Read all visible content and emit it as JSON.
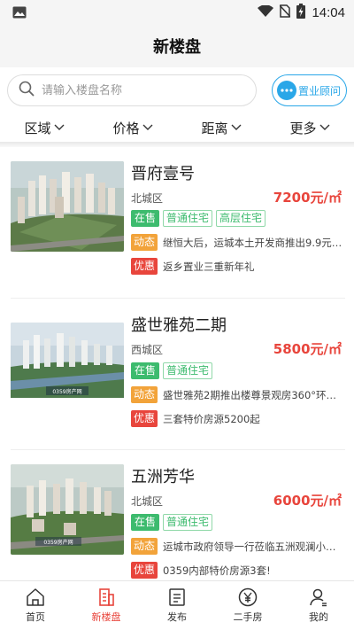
{
  "status_bar": {
    "time": "14:04",
    "icons": [
      "gallery-icon",
      "wifi-icon",
      "no-sim-icon",
      "battery-charging-icon"
    ]
  },
  "page": {
    "title": "新楼盘"
  },
  "search": {
    "placeholder": "请输入楼盘名称",
    "value": ""
  },
  "consultant": {
    "label": "置业顾问",
    "icon": "chat-bubble-icon"
  },
  "filters": [
    {
      "label": "区域"
    },
    {
      "label": "价格"
    },
    {
      "label": "距离"
    },
    {
      "label": "更多"
    }
  ],
  "listings": [
    {
      "name": "晋府壹号",
      "district": "北城区",
      "price": "7200元/㎡",
      "status": "在售",
      "types": [
        "普通住宅",
        "高层住宅"
      ],
      "news_badge": "动态",
      "news": "继恒大后，运城本土开发商推出9.9元…",
      "promo_badge": "优惠",
      "promo": "返乡置业三重新年礼"
    },
    {
      "name": "盛世雅苑二期",
      "district": "西城区",
      "price": "5800元/㎡",
      "status": "在售",
      "types": [
        "普通住宅"
      ],
      "news_badge": "动态",
      "news": "盛世雅苑2期推出楼尊景观房360°环景…",
      "promo_badge": "优惠",
      "promo": "三套特价房源5200起",
      "thumb_watermark": "0359房产网"
    },
    {
      "name": "五洲芳华",
      "district": "北城区",
      "price": "6000元/㎡",
      "status": "在售",
      "types": [
        "普通住宅"
      ],
      "news_badge": "动态",
      "news": "运城市政府领导一行莅临五洲观澜小区…",
      "promo_badge": "优惠",
      "promo": "0359内部特价房源3套!",
      "thumb_watermark": "0359房产网"
    }
  ],
  "nav": [
    {
      "label": "首页",
      "icon": "home-icon",
      "active": false
    },
    {
      "label": "新楼盘",
      "icon": "new-building-icon",
      "active": true
    },
    {
      "label": "发布",
      "icon": "publish-icon",
      "active": false
    },
    {
      "label": "二手房",
      "icon": "yuan-icon",
      "active": false
    },
    {
      "label": "我的",
      "icon": "user-icon",
      "active": false
    }
  ]
}
